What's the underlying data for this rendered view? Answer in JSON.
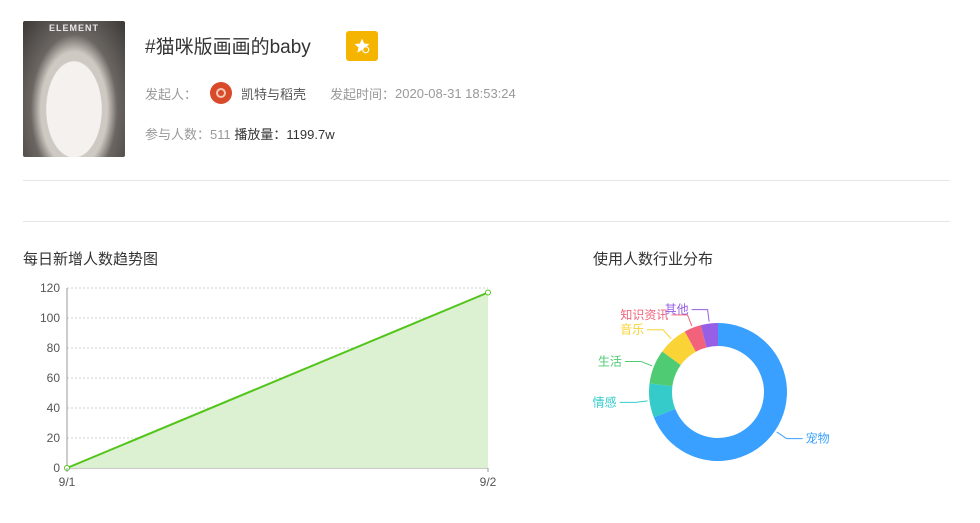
{
  "cover": {
    "brand_text": "ELEMENT"
  },
  "topic": {
    "title": "#猫咪版画画的baby"
  },
  "meta": {
    "initiator_label": "发起人：",
    "initiator_name": "凯特与稻壳",
    "time_label": "发起时间：",
    "time_value": "2020-08-31 18:53:24",
    "participants_label": "参与人数：",
    "participants_value": "511",
    "plays_label": "播放量：",
    "plays_value": "1199.7w"
  },
  "colors": {
    "accent_line": "#52c41a",
    "area_fill": "#d9f0cf",
    "badge": "#f5b400"
  },
  "chart_data": [
    {
      "type": "area",
      "title": "每日新增人数趋势图",
      "categories": [
        "9/1",
        "9/2"
      ],
      "values": [
        0,
        117
      ],
      "ylim": [
        0,
        120
      ],
      "yticks": [
        0,
        20,
        40,
        60,
        80,
        100,
        120
      ],
      "grid": true
    },
    {
      "type": "pie",
      "title": "使用人数行业分布",
      "donut": true,
      "slices": [
        {
          "label": "宠物",
          "value": 69,
          "color": "#3aa0ff"
        },
        {
          "label": "情感",
          "value": 8,
          "color": "#36cbcb"
        },
        {
          "label": "生活",
          "value": 8,
          "color": "#4ecb73"
        },
        {
          "label": "音乐",
          "value": 7,
          "color": "#fad337"
        },
        {
          "label": "知识资讯",
          "value": 4,
          "color": "#f2637b"
        },
        {
          "label": "其他",
          "value": 4,
          "color": "#975fe5"
        }
      ]
    }
  ]
}
